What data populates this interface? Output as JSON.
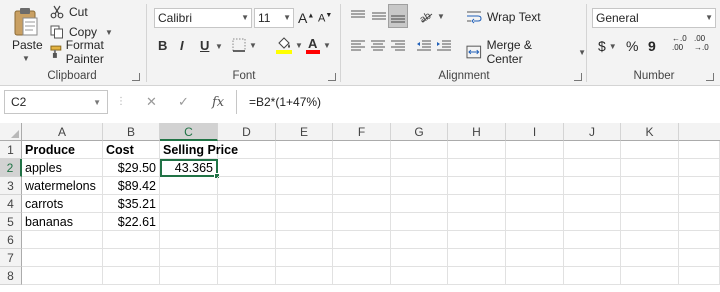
{
  "ribbon": {
    "clipboard": {
      "paste_label": "Paste",
      "cut_label": "Cut",
      "copy_label": "Copy",
      "format_painter_label": "Format Painter",
      "group_label": "Clipboard"
    },
    "font": {
      "font_name": "Calibri",
      "font_size": "11",
      "bold": "B",
      "italic": "I",
      "underline": "U",
      "group_label": "Font",
      "highlight_color": "#ffff00",
      "font_color": "#ff0000"
    },
    "alignment": {
      "wrap_text_label": "Wrap Text",
      "merge_center_label": "Merge & Center",
      "group_label": "Alignment"
    },
    "number": {
      "format_value": "General",
      "currency_symbol": "$",
      "percent_symbol": "%",
      "comma_symbol": "9",
      "increase_decimal": "←.0\n.00",
      "decrease_decimal": ".00\n→.0",
      "group_label": "Number"
    }
  },
  "formula_bar": {
    "name_box": "C2",
    "cancel_icon": "✕",
    "enter_icon": "✓",
    "fx_label": "fx",
    "formula": "=B2*(1+47%)"
  },
  "sheet": {
    "columns": [
      "A",
      "B",
      "C",
      "D",
      "E",
      "F",
      "G",
      "H",
      "I",
      "J",
      "K"
    ],
    "rows": [
      "1",
      "2",
      "3",
      "4",
      "5",
      "6",
      "7",
      "8"
    ],
    "cells": {
      "A1": "Produce",
      "B1": "Cost",
      "C1": "Selling Price",
      "A2": "apples",
      "B2": "$29.50",
      "C2": "43.365",
      "A3": "watermelons",
      "B3": "$89.42",
      "A4": "carrots",
      "B4": "$35.21",
      "A5": "bananas",
      "B5": "$22.61"
    },
    "active_cell": "C2",
    "accent_color": "#217346"
  }
}
